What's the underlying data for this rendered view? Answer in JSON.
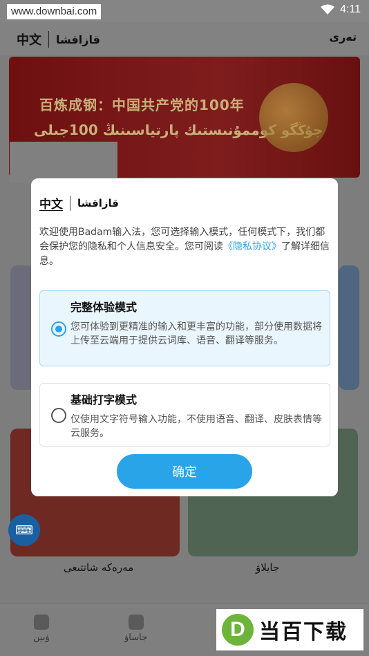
{
  "statusbar": {
    "watermark_url": "www.downbai.com",
    "time": "4:11"
  },
  "appbar": {
    "lang_zh": "中文",
    "lang_kz": "قازاقشا",
    "right_text": "تەرى"
  },
  "banner": {
    "line1": "百炼成钢：中国共产党的100年",
    "line2": "جۇڭگو كوممۇنىستىك پارتياسىنىڭ 100جىلى"
  },
  "background": {
    "card_left_label": "مەرەكە شاتتىعى",
    "card_right_label": "جايلاۋ",
    "nav": [
      {
        "label": "ۋىين"
      },
      {
        "label": "جاساۋ"
      }
    ]
  },
  "watermark_logo": {
    "letter": "D",
    "text": "当百下载"
  },
  "dialog": {
    "lang_zh": "中文",
    "lang_kz": "قازاقشا",
    "desc_prefix": "欢迎使用Badam输入法，您可选择输入模式，任何模式下，我们都会保护您的隐私和个人信息安全。您可阅读",
    "desc_link": "《隐私协议》",
    "desc_suffix": "了解详细信息。",
    "options": [
      {
        "title": "完整体验模式",
        "desc": "您可体验到更精准的输入和更丰富的功能，部分使用数据将上传至云端用于提供云词库、语音、翻译等服务。",
        "selected": true
      },
      {
        "title": "基础打字模式",
        "desc": "仅使用文字符号输入功能，不使用语音、翻译、皮肤表情等云服务。",
        "selected": false
      }
    ],
    "confirm_label": "确定"
  },
  "colors": {
    "accent": "#2aa4e8",
    "selected_bg": "#eaf6fd"
  }
}
